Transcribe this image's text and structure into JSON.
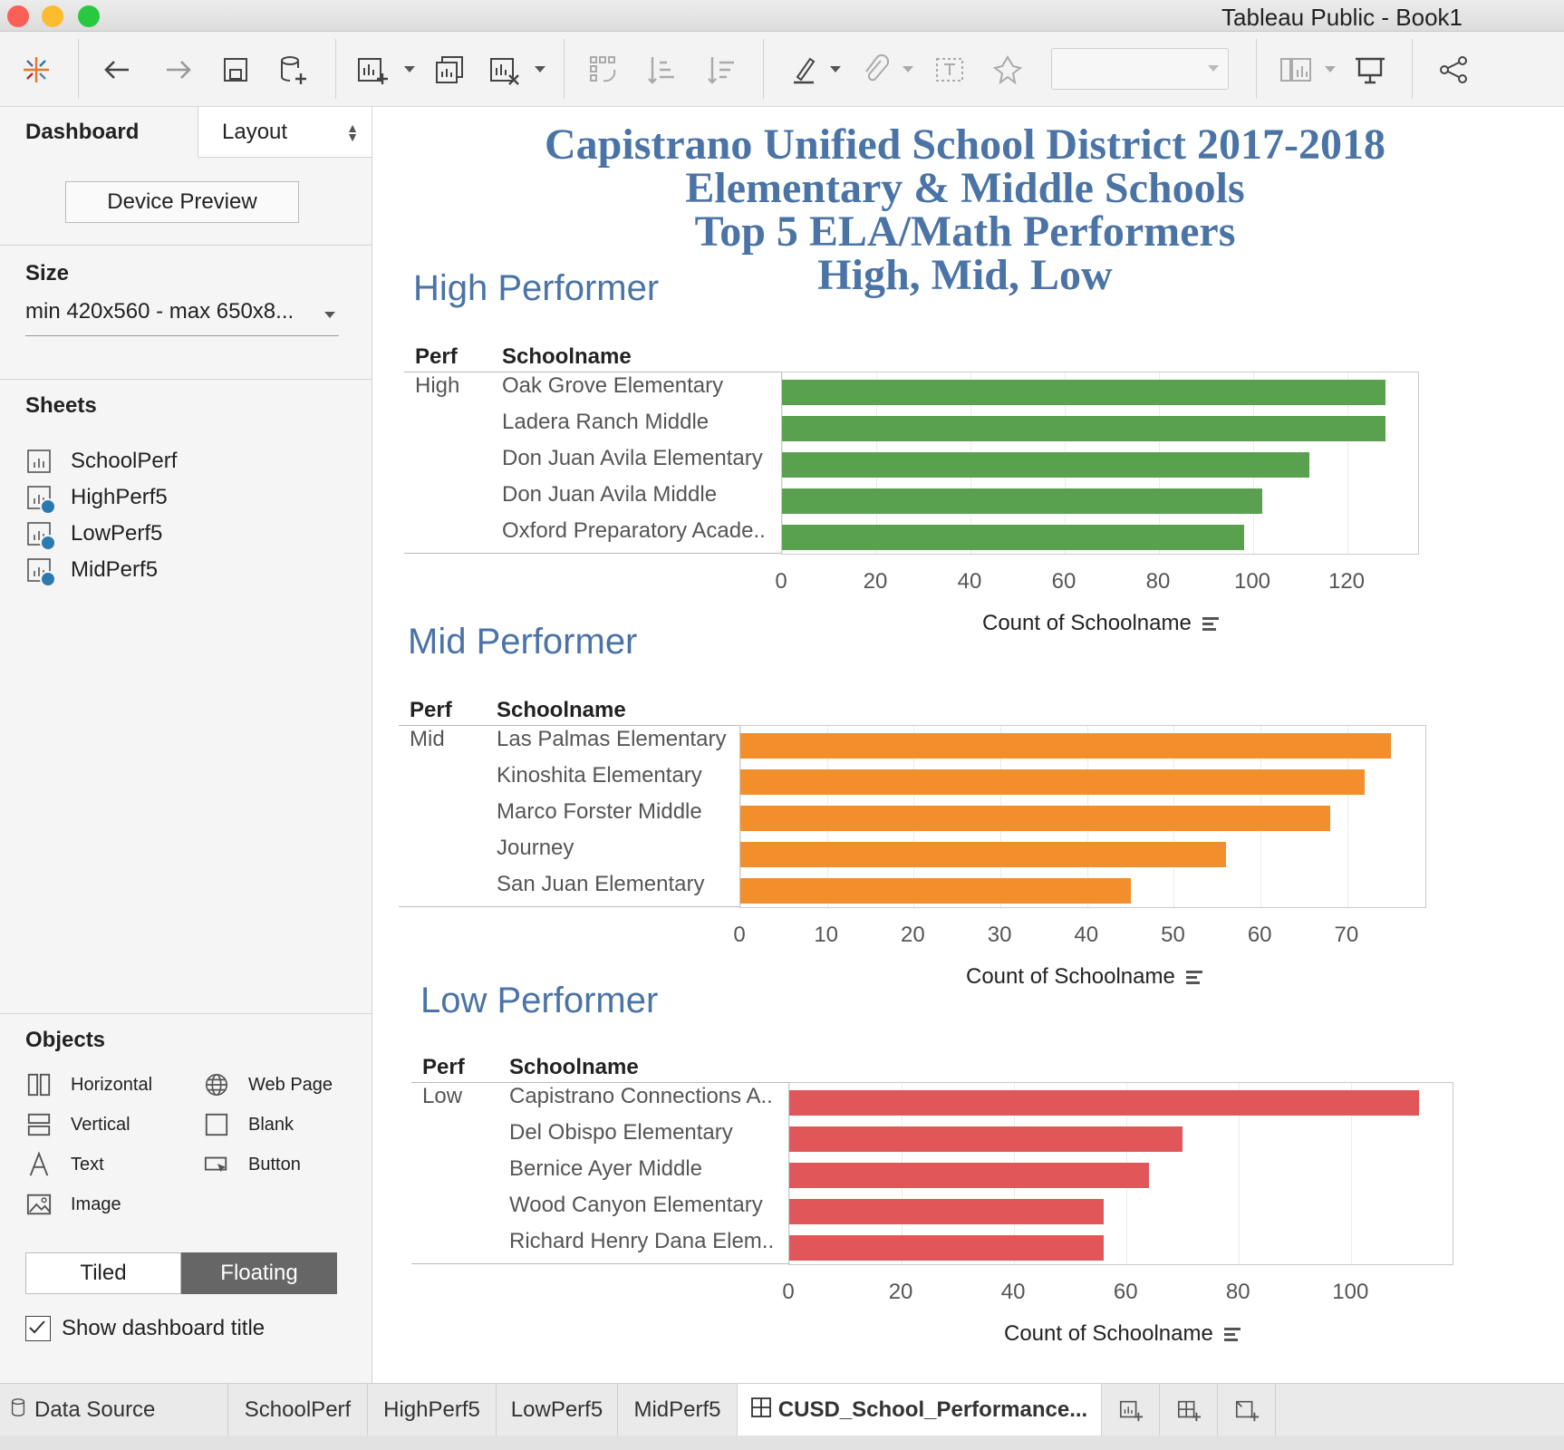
{
  "window": {
    "title": "Tableau Public - Book1"
  },
  "left_panel": {
    "tabs": {
      "dashboard": "Dashboard",
      "layout": "Layout"
    },
    "device_preview_label": "Device Preview",
    "size": {
      "heading": "Size",
      "value": "min 420x560 - max 650x8..."
    },
    "sheets": {
      "heading": "Sheets",
      "items": [
        "SchoolPerf",
        "HighPerf5",
        "LowPerf5",
        "MidPerf5"
      ]
    },
    "objects": {
      "heading": "Objects",
      "items": [
        "Horizontal",
        "Web Page",
        "Vertical",
        "Blank",
        "Text",
        "Button",
        "Image"
      ]
    },
    "layout_mode": {
      "tiled": "Tiled",
      "floating": "Floating",
      "selected": "Floating"
    },
    "show_dashboard_title": {
      "label": "Show dashboard title",
      "checked": true
    }
  },
  "dashboard": {
    "title_lines": [
      "Capistrano Unified School District 2017-2018",
      "Elementary & Middle Schools",
      "Top 5 ELA/Math Performers",
      "High, Mid, Low"
    ]
  },
  "chart_data": [
    {
      "type": "bar",
      "orientation": "horizontal",
      "title": "High Performer",
      "row_headers": [
        "Perf",
        "Schoolname"
      ],
      "perf": "High",
      "categories": [
        "Oak Grove Elementary",
        "Ladera Ranch Middle",
        "Don Juan Avila Elementary",
        "Don Juan Avila Middle",
        "Oxford Preparatory Acade.."
      ],
      "values": [
        128,
        128,
        112,
        102,
        98
      ],
      "xlabel": "Count of Schoolname",
      "xticks": [
        "0",
        "20",
        "40",
        "60",
        "80",
        "100",
        "120"
      ],
      "xlim": [
        0,
        135
      ],
      "color": "#59a14f"
    },
    {
      "type": "bar",
      "orientation": "horizontal",
      "title": "Mid Performer",
      "row_headers": [
        "Perf",
        "Schoolname"
      ],
      "perf": "Mid",
      "categories": [
        "Las Palmas Elementary",
        "Kinoshita Elementary",
        "Marco Forster Middle",
        "Journey",
        "San Juan Elementary"
      ],
      "values": [
        75,
        72,
        68,
        56,
        45
      ],
      "xlabel": "Count of Schoolname",
      "xticks": [
        "0",
        "10",
        "20",
        "30",
        "40",
        "50",
        "60",
        "70"
      ],
      "xlim": [
        0,
        79
      ],
      "color": "#f28e2b"
    },
    {
      "type": "bar",
      "orientation": "horizontal",
      "title": "Low Performer",
      "row_headers": [
        "Perf",
        "Schoolname"
      ],
      "perf": "Low",
      "categories": [
        "Capistrano Connections A..",
        "Del Obispo Elementary",
        "Bernice Ayer Middle",
        "Wood Canyon Elementary",
        "Richard Henry Dana Elem.."
      ],
      "values": [
        112,
        70,
        64,
        56,
        56
      ],
      "xlabel": "Count of Schoolname",
      "xticks": [
        "0",
        "20",
        "40",
        "60",
        "80",
        "100"
      ],
      "xlim": [
        0,
        118
      ],
      "color": "#e15759"
    }
  ],
  "bottom_tabs": {
    "data_source": "Data Source",
    "sheets": [
      "SchoolPerf",
      "HighPerf5",
      "LowPerf5",
      "MidPerf5"
    ],
    "active_dashboard": "CUSD_School_Performance..."
  },
  "colors": {
    "accent": "#4a73a6",
    "high": "#59a14f",
    "mid": "#f28e2b",
    "low": "#e15759"
  },
  "toolbar_icons": [
    "tableau-logo-icon",
    "back-icon",
    "forward-icon",
    "save-icon",
    "new-datasource-icon",
    "new-worksheet-icon",
    "duplicate-sheet-icon",
    "clear-sheet-icon",
    "swap-icon",
    "sort-ascending-icon",
    "sort-descending-icon",
    "highlight-icon",
    "group-icon",
    "label-icon",
    "fix-axes-icon",
    "fit-dropdown",
    "show-cards-icon",
    "presentation-icon",
    "share-icon"
  ]
}
